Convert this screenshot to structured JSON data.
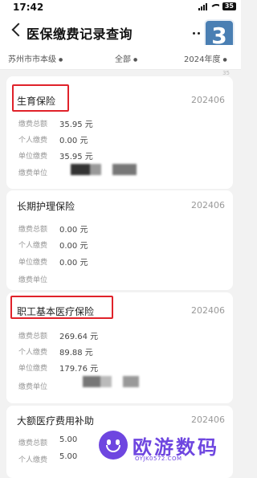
{
  "status_bar": {
    "time": "17:42",
    "battery": "35"
  },
  "nav": {
    "title": "医保缴费记录查询"
  },
  "tutorial_step": "3",
  "filters": {
    "city": "苏州市市本级",
    "type": "全部",
    "year": "2024年度"
  },
  "partial_count": "35",
  "labels": {
    "total": "缴费总额",
    "personal": "个人缴费",
    "employer": "单位缴费",
    "unit": "缴费单位"
  },
  "records": [
    {
      "title": "生育保险",
      "period": "202406",
      "total": "35.95 元",
      "personal": "0.00 元",
      "employer": "35.95 元"
    },
    {
      "title": "长期护理保险",
      "period": "202406",
      "total": "0.00 元",
      "personal": "0.00 元",
      "employer": "0.00 元"
    },
    {
      "title": "职工基本医疗保险",
      "period": "202406",
      "total": "269.64 元",
      "personal": "89.88 元",
      "employer": "179.76 元"
    },
    {
      "title": "大额医疗费用补助",
      "period": "202406",
      "total": "5.00",
      "personal": "5.00"
    }
  ],
  "watermark": {
    "brand": "欧游数码",
    "url": "OYJK0572.COM"
  },
  "colors": {
    "highlight": "#e0222a",
    "badge": "#4a7fb3",
    "watermark": "#6e46e0"
  }
}
